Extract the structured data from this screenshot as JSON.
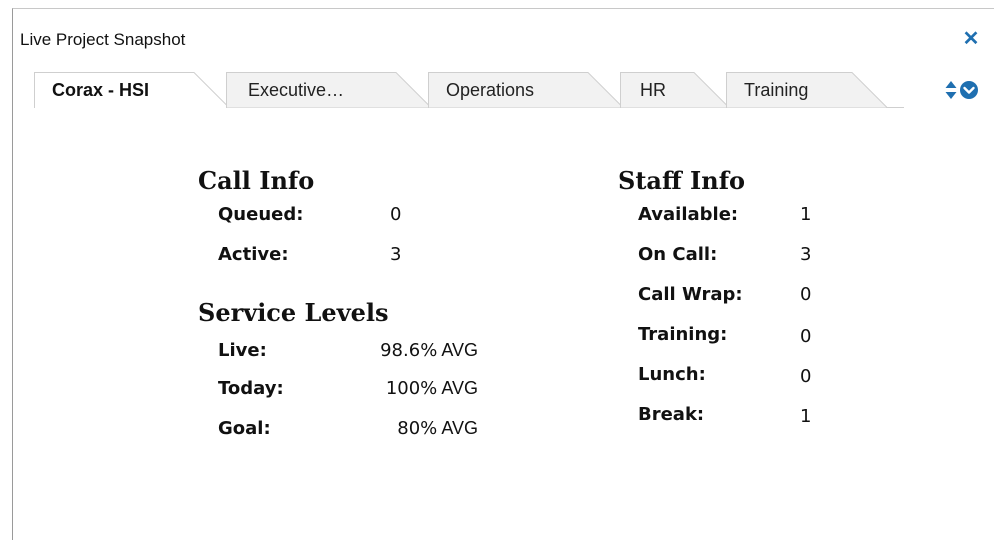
{
  "window": {
    "title": "Live Project Snapshot",
    "close_icon": "close-x-icon"
  },
  "tabs": [
    {
      "label": "Corax - HSI",
      "active": true
    },
    {
      "label": "Executive…",
      "active": false
    },
    {
      "label": "Operations",
      "active": false
    },
    {
      "label": "HR",
      "active": false
    },
    {
      "label": "Training",
      "active": false
    }
  ],
  "call_info": {
    "title": "Call Info",
    "rows": [
      {
        "label": "Queued:",
        "value": "0"
      },
      {
        "label": "Active:",
        "value": "3"
      }
    ]
  },
  "service_levels": {
    "title": "Service Levels",
    "rows": [
      {
        "label": "Live:",
        "value": "98.6%",
        "unit": "AVG"
      },
      {
        "label": "Today:",
        "value": "100%",
        "unit": "AVG"
      },
      {
        "label": "Goal:",
        "value": "80%",
        "unit": "AVG"
      }
    ]
  },
  "staff_info": {
    "title": "Staff Info",
    "rows": [
      {
        "label": "Available:",
        "value": "1"
      },
      {
        "label": "On Call:",
        "value": "3"
      },
      {
        "label": "Call Wrap:",
        "value": "0"
      },
      {
        "label": "Training:",
        "value": "0"
      },
      {
        "label": "Lunch:",
        "value": "0"
      },
      {
        "label": "Break:",
        "value": "1"
      }
    ]
  },
  "colors": {
    "accent": "#1f6fb0",
    "tab_active_bg": "#ffffff",
    "tab_inactive_bg": "#f2f2f2",
    "tab_border": "#cfcfcf"
  }
}
